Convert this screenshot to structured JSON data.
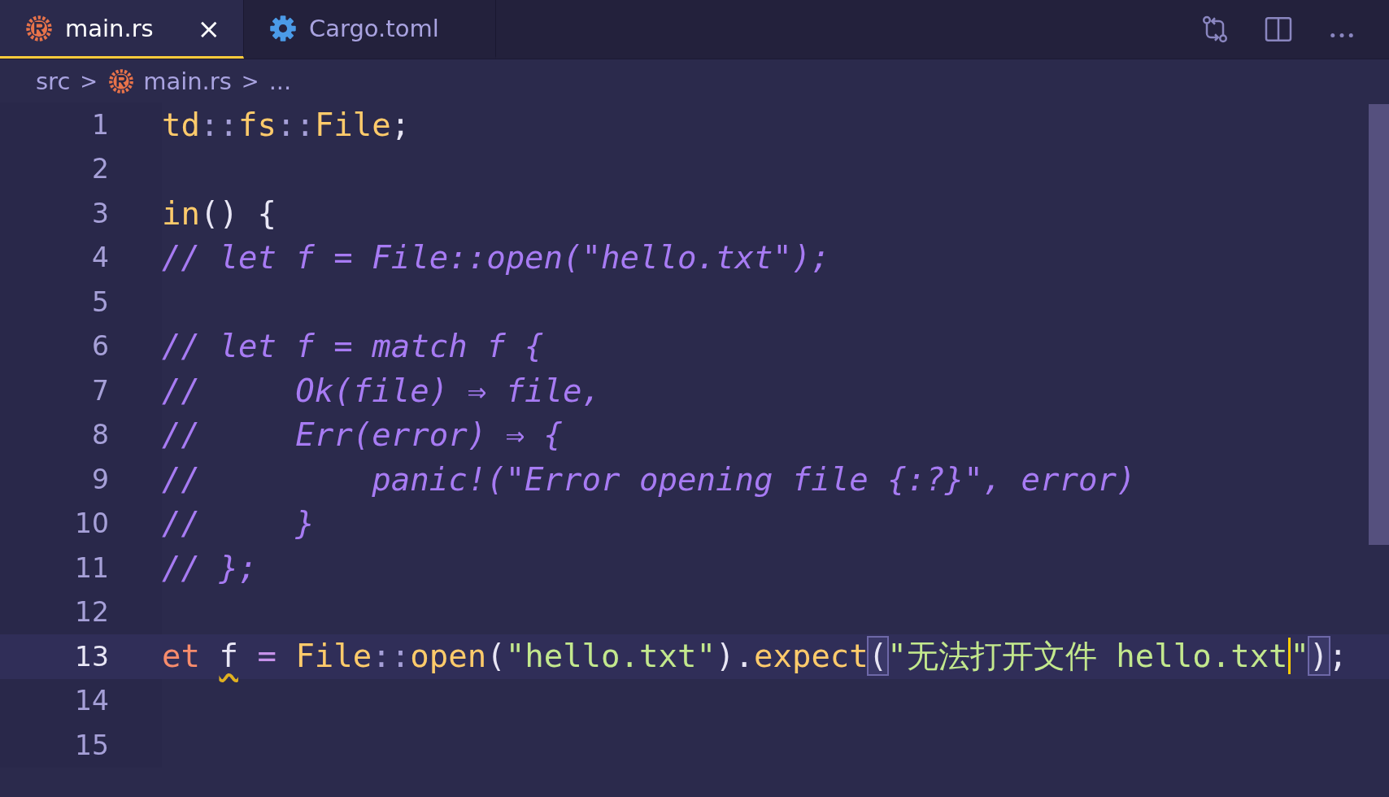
{
  "tabs": [
    {
      "label": "main.rs",
      "selected": true,
      "close": "×"
    },
    {
      "label": "Cargo.toml",
      "selected": false
    }
  ],
  "breadcrumbs": [
    {
      "label": "src"
    },
    {
      "label": "main.rs"
    },
    {
      "label": "..."
    }
  ],
  "breadcrumb_separator": ">",
  "lines": [
    {
      "number": "1",
      "current": false,
      "tokens": [
        {
          "text": "td",
          "kind": "type"
        },
        {
          "text": "::",
          "kind": "punct"
        },
        {
          "text": "fs",
          "kind": "type"
        },
        {
          "text": "::",
          "kind": "punct"
        },
        {
          "text": "File",
          "kind": "type"
        },
        {
          "text": ";",
          "kind": "plain"
        }
      ]
    },
    {
      "number": "2",
      "current": false
    },
    {
      "number": "3",
      "current": false,
      "tokens": [
        {
          "text": "in",
          "kind": "fn"
        },
        {
          "text": "() {",
          "kind": "plain"
        }
      ]
    },
    {
      "number": "4",
      "current": false,
      "tokens": [
        {
          "text": "// let f = File::open(\"hello.txt\");",
          "kind": "comment"
        }
      ]
    },
    {
      "number": "5",
      "current": false
    },
    {
      "number": "6",
      "current": false,
      "tokens": [
        {
          "text": "// let f = match f {",
          "kind": "comment"
        }
      ]
    },
    {
      "number": "7",
      "current": false,
      "tokens": [
        {
          "text": "//     Ok(file) ⇒ file,",
          "kind": "comment"
        }
      ]
    },
    {
      "number": "8",
      "current": false,
      "tokens": [
        {
          "text": "//     Err(error) ⇒ {",
          "kind": "comment"
        }
      ]
    },
    {
      "number": "9",
      "current": false,
      "tokens": [
        {
          "text": "//         panic!(\"Error opening file {:?}\", error)",
          "kind": "comment"
        }
      ]
    },
    {
      "number": "10",
      "current": false,
      "tokens": [
        {
          "text": "//     }",
          "kind": "comment"
        }
      ]
    },
    {
      "number": "11",
      "current": false,
      "tokens": [
        {
          "text": "// };",
          "kind": "comment"
        }
      ]
    },
    {
      "number": "12",
      "current": false
    },
    {
      "number": "13",
      "current": true,
      "tokens": [
        {
          "text": "et ",
          "kind": "keyword"
        },
        {
          "text": "f",
          "kind": "plain",
          "warning": true
        },
        {
          "text": " = ",
          "kind": "op"
        },
        {
          "text": "File",
          "kind": "type"
        },
        {
          "text": "::",
          "kind": "punct"
        },
        {
          "text": "open",
          "kind": "fn"
        },
        {
          "text": "(",
          "kind": "plain"
        },
        {
          "text": "\"hello.txt\"",
          "kind": "string"
        },
        {
          "text": ")",
          "kind": "plain"
        },
        {
          "text": ".",
          "kind": "plain"
        },
        {
          "text": "expect",
          "kind": "fn"
        },
        {
          "text": "(",
          "kind": "plain",
          "matched": true
        },
        {
          "text": "\"无法打开文件 hello.txt",
          "kind": "string"
        },
        {
          "text": "\"",
          "kind": "string",
          "cursor_before": true
        },
        {
          "text": ")",
          "kind": "plain",
          "matched": true
        },
        {
          "text": ";",
          "kind": "plain"
        }
      ]
    },
    {
      "number": "14",
      "current": false
    },
    {
      "number": "15",
      "current": false
    }
  ]
}
